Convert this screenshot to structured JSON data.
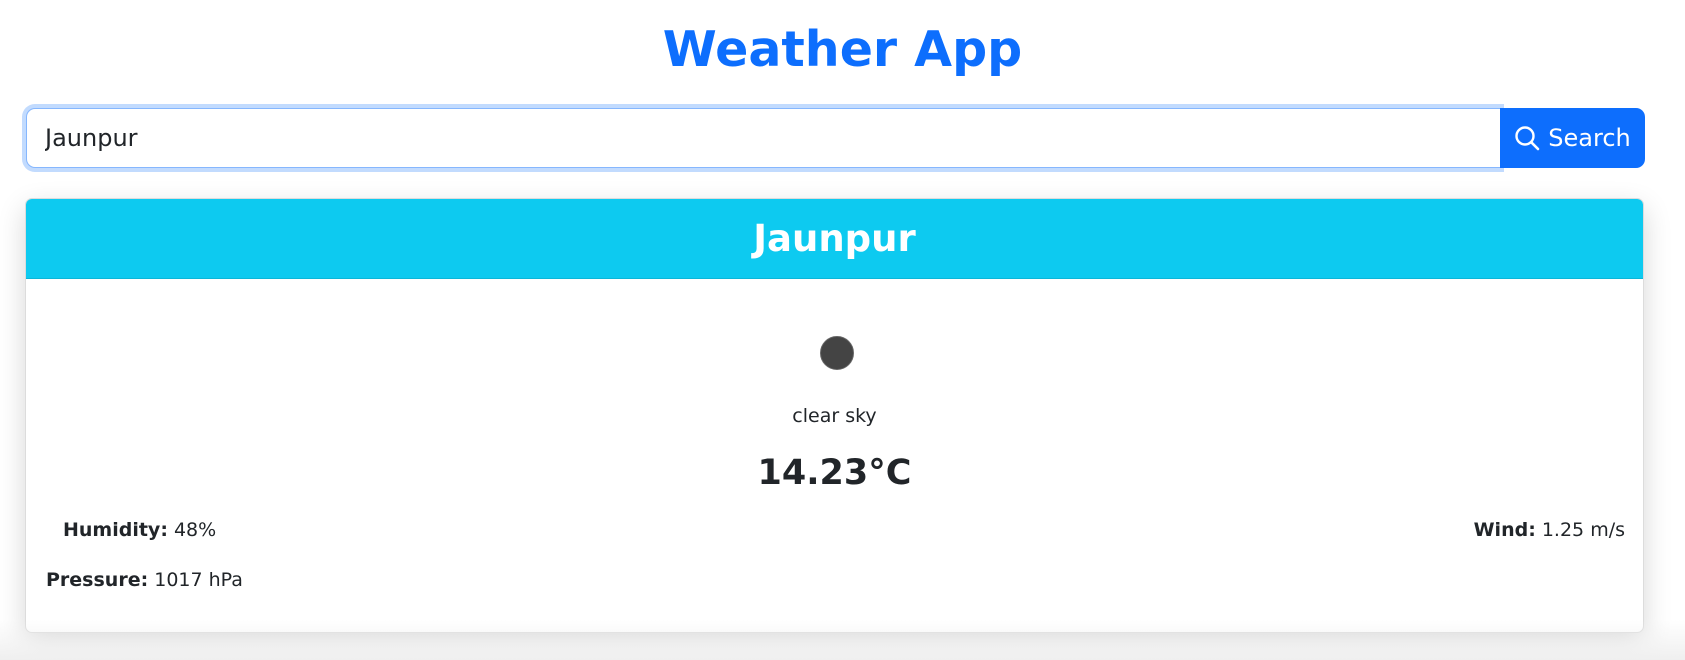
{
  "app": {
    "title": "Weather App"
  },
  "search": {
    "value": "Jaunpur",
    "button_label": "Search",
    "button_icon": "search-icon"
  },
  "weather": {
    "city": "Jaunpur",
    "description": "clear sky",
    "temperature": "14.23°C",
    "icon": "weather-condition-icon",
    "humidity_label": "Humidity:",
    "humidity_value": "48%",
    "wind_label": "Wind:",
    "wind_value": "1.25 m/s",
    "pressure_label": "Pressure:",
    "pressure_value": "1017 hPa"
  },
  "colors": {
    "primary": "#0d6efd",
    "header": "#0dcaf0",
    "text": "#212529"
  }
}
